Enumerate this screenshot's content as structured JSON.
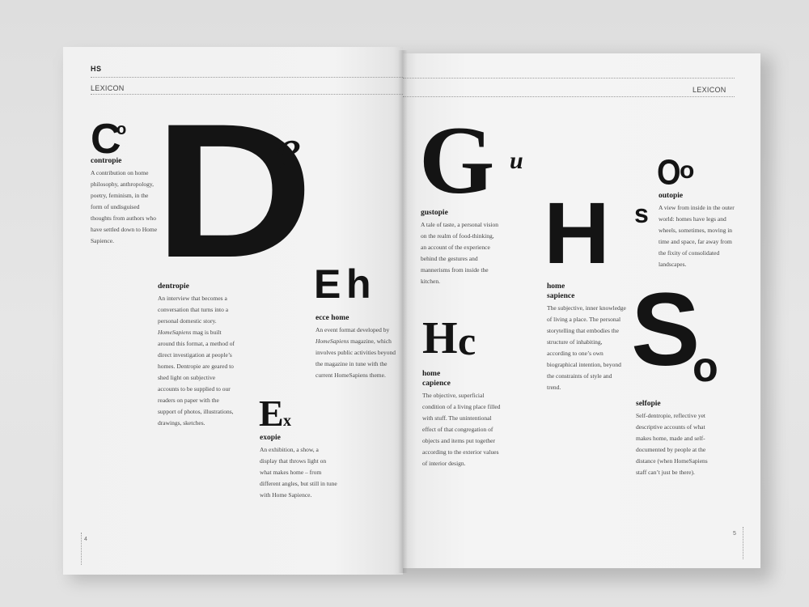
{
  "header": {
    "logo": "HS",
    "section_left": "LEXICON",
    "section_right": "LEXICON"
  },
  "footer": {
    "page_left": "4",
    "page_right": "5"
  },
  "entries": {
    "contropie": {
      "big": "C",
      "small": "o",
      "term": "contropie",
      "description": "A contribution on home philosophy, anthropology, poetry, feminism, in the form of undisguised thoughts from authors who have settled down to Home Sapience."
    },
    "dentropie": {
      "big": "D",
      "small": "e",
      "term": "dentropie",
      "description_a": "An interview that becomes a conversation that turns into a personal domestic story.",
      "description_em": "HomeSapiens",
      "description_b": "mag is built around this format, a method of direct investigation at people’s homes. Dentropie are geared to shed light on subjective accounts to be supplied to our readers on paper with the support of photos, illustrations, drawings, sketches."
    },
    "ecce_home": {
      "big": "E",
      "small": "h",
      "term": "ecce home",
      "description_a": "An event format developed by",
      "description_em": "HomeSapiens",
      "description_b": "magazine, which involves public activities beyond the magazine in tune with the current HomeSapiens theme."
    },
    "exopie": {
      "big": "E",
      "small": "x",
      "term": "exopie",
      "description": "An exhibition, a show, a display that throws light on what makes home – from different angles, but still in tune with Home Sapience."
    },
    "gustopie": {
      "big": "G",
      "small": "u",
      "term": "gustopie",
      "description": "A tale of taste, a personal vision on the realm of food-thinking, an account of the experience behind the gestures and mannerisms from inside the kitchen."
    },
    "home_capience": {
      "big": "H",
      "small": "c",
      "term_line1": "home",
      "term_line2": "capience",
      "description": "The objective, superficial condition of a living place filled with stuff. The unintentional effect of that congregation of objects and items put together according to the exterior values of interior design."
    },
    "home_sapience": {
      "big": "H",
      "small": "s",
      "term_line1": "home",
      "term_line2": "sapience",
      "description": "The subjective, inner knowledge of living a place. The personal storytelling that embodies the structure of inhabiting, according to one’s own biographical intention, beyond the constraints of style and trend."
    },
    "outopie": {
      "big": "O",
      "small": "o",
      "term": "outopie",
      "description": "A view from inside in the outer world: homes have legs and wheels, sometimes, moving in time and space, far away from the fixity of consolidated landscapes."
    },
    "selfopie": {
      "big": "S",
      "small": "o",
      "term": "selfopie",
      "description": "Self-dentropie, reflective yet descriptive accounts of what makes home, made and self-documented by people at the distance (when HomeSapiens staff can’t just be there)."
    }
  }
}
